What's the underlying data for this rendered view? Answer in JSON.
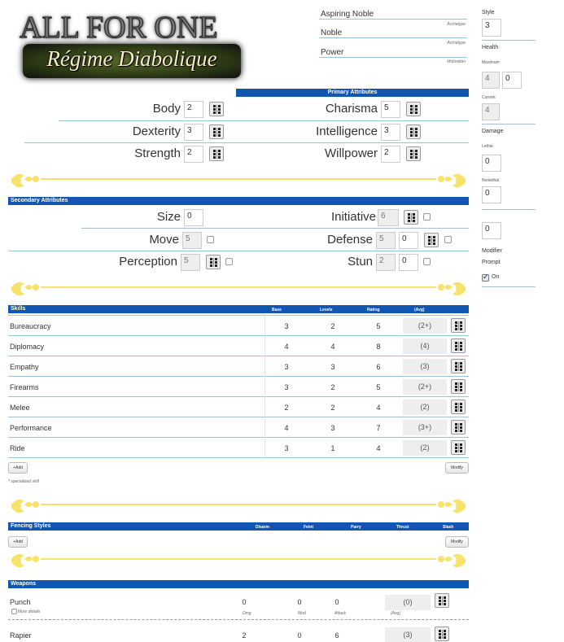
{
  "logo": {
    "title": "ALL FOR ONE",
    "subtitle": "Régime Diabolique"
  },
  "header": {
    "fields": [
      {
        "value": "Aspiring Noble",
        "caption": ""
      },
      {
        "value": "Noble",
        "caption": "Archetype"
      },
      {
        "value": "Power",
        "caption": "Archetype"
      }
    ],
    "last_caption": "Motivation"
  },
  "side": {
    "style_label": "Style",
    "style_value": "3",
    "health_label": "Health",
    "maximum_label": "Maximum",
    "max_value": "4",
    "max_extra": "0",
    "current_label": "Current",
    "current_value": "4",
    "damage_label": "Damage",
    "lethal_label": "Lethal",
    "lethal_value": "0",
    "nonlethal_label": "Nonlethal",
    "nonlethal_value": "0",
    "extra_value": "0",
    "modifier_label": "Modifier",
    "prompt_label": "Prompt",
    "on_label": "On",
    "on_checked": true
  },
  "primary": {
    "title": "Primary Attributes",
    "left": [
      {
        "label": "Body",
        "value": "2"
      },
      {
        "label": "Dexterity",
        "value": "3"
      },
      {
        "label": "Strength",
        "value": "2"
      }
    ],
    "right": [
      {
        "label": "Charisma",
        "value": "5"
      },
      {
        "label": "Intelligence",
        "value": "3"
      },
      {
        "label": "Willpower",
        "value": "2"
      }
    ]
  },
  "secondary": {
    "title": "Secondary Attributes",
    "size": {
      "label": "Size",
      "value": "0"
    },
    "move": {
      "label": "Move",
      "value": "5"
    },
    "perception": {
      "label": "Perception",
      "value": "5"
    },
    "initiative": {
      "label": "Initiative",
      "value": "6"
    },
    "defense": {
      "label": "Defense",
      "value": "5",
      "extra": "0"
    },
    "stun": {
      "label": "Stun",
      "value": "2",
      "extra": "0"
    }
  },
  "skills": {
    "title": "Skills",
    "columns": [
      "Base",
      "Levels",
      "Rating",
      "(Avg)"
    ],
    "rows": [
      {
        "name": "Bureaucracy",
        "base": "3",
        "levels": "2",
        "rating": "5",
        "avg": "(2+)"
      },
      {
        "name": "Diplomacy",
        "base": "4",
        "levels": "4",
        "rating": "8",
        "avg": "(4)"
      },
      {
        "name": "Empathy",
        "base": "3",
        "levels": "3",
        "rating": "6",
        "avg": "(3)"
      },
      {
        "name": "Firearms",
        "base": "3",
        "levels": "2",
        "rating": "5",
        "avg": "(2+)"
      },
      {
        "name": "Melee",
        "base": "2",
        "levels": "2",
        "rating": "4",
        "avg": "(2)"
      },
      {
        "name": "Performance",
        "base": "4",
        "levels": "3",
        "rating": "7",
        "avg": "(3+)"
      },
      {
        "name": "Ride",
        "base": "3",
        "levels": "1",
        "rating": "4",
        "avg": "(2)"
      }
    ],
    "add_label": "+Add",
    "modify_label": "Modify",
    "note": "* specialized skill"
  },
  "fencing": {
    "title": "Fencing Styles",
    "columns": [
      "Disarm",
      "Feint",
      "Parry",
      "Thrust",
      "Slash"
    ],
    "add_label": "+Add",
    "modify_label": "Modify"
  },
  "weapons": {
    "title": "Weapons",
    "rows": [
      {
        "name": "Punch",
        "dmg": "0",
        "mod": "0",
        "attack": "0",
        "avg": "(0)"
      },
      {
        "name": "Rapier",
        "dmg": "2",
        "mod": "0",
        "attack": "6",
        "avg": "(3)"
      }
    ],
    "captions": {
      "dmg": "Dmg",
      "mod": "Mod",
      "attack": "Attack",
      "avg": "(Avg)"
    },
    "more_details": "More details"
  },
  "colors": {
    "bar": "#1156b0",
    "flourish": "#f7e36b",
    "line": "#9cc3d9"
  }
}
